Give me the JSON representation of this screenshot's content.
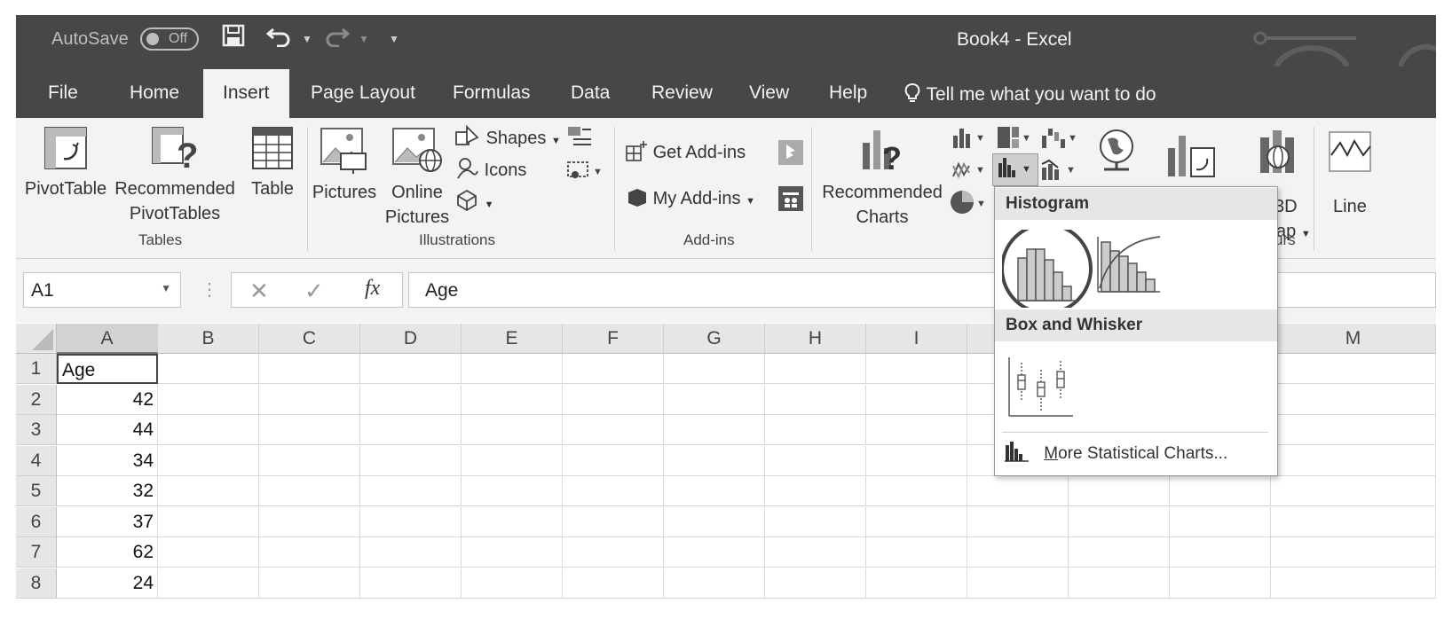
{
  "titlebar": {
    "autosave_label": "AutoSave",
    "autosave_state": "Off",
    "title": "Book4  -  Excel"
  },
  "tabs": [
    {
      "label": "File"
    },
    {
      "label": "Home"
    },
    {
      "label": "Insert",
      "active": true
    },
    {
      "label": "Page Layout"
    },
    {
      "label": "Formulas"
    },
    {
      "label": "Data"
    },
    {
      "label": "Review"
    },
    {
      "label": "View"
    },
    {
      "label": "Help"
    }
  ],
  "tell_me": "Tell me what you want to do",
  "ribbon": {
    "tables": {
      "pivottable": "PivotTable",
      "recommended_pivot_1": "Recommended",
      "recommended_pivot_2": "PivotTables",
      "table": "Table",
      "group": "Tables"
    },
    "illustrations": {
      "pictures": "Pictures",
      "online_1": "Online",
      "online_2": "Pictures",
      "shapes": "Shapes",
      "icons": "Icons",
      "group": "Illustrations"
    },
    "addins": {
      "get": "Get Add-ins",
      "my": "My Add-ins",
      "group": "Add-ins"
    },
    "charts": {
      "recommended_1": "Recommended",
      "recommended_2": "Charts",
      "d3": "3D",
      "map_partial": "ap",
      "tours_partial": "urs",
      "line": "Line"
    }
  },
  "formula_bar": {
    "name_box": "A1",
    "fx": "fx",
    "value": "Age"
  },
  "columns": [
    "A",
    "B",
    "C",
    "D",
    "E",
    "F",
    "G",
    "H",
    "I",
    "M"
  ],
  "rows": [
    {
      "n": "1",
      "a": "Age"
    },
    {
      "n": "2",
      "a": "42"
    },
    {
      "n": "3",
      "a": "44"
    },
    {
      "n": "4",
      "a": "34"
    },
    {
      "n": "5",
      "a": "32"
    },
    {
      "n": "6",
      "a": "37"
    },
    {
      "n": "7",
      "a": "62"
    },
    {
      "n": "8",
      "a": "24"
    }
  ],
  "dropdown": {
    "histogram_header": "Histogram",
    "box_header": "Box and Whisker",
    "more_first": "M",
    "more_rest": "ore Statistical Charts..."
  },
  "colors": {
    "titlebar": "#474747",
    "ribbon": "#f3f3f3",
    "header_cell": "#e6e6e6"
  }
}
